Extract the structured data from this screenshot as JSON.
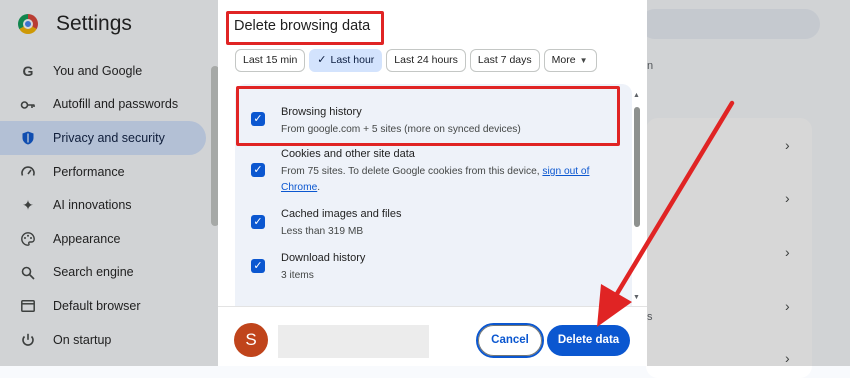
{
  "settings": {
    "title": "Settings",
    "nav": [
      {
        "label": "You and Google",
        "icon": "google-g-icon"
      },
      {
        "label": "Autofill and passwords",
        "icon": "key-icon"
      },
      {
        "label": "Privacy and security",
        "icon": "shield-icon"
      },
      {
        "label": "Performance",
        "icon": "speedometer-icon"
      },
      {
        "label": "AI innovations",
        "icon": "sparkle-icon"
      },
      {
        "label": "Appearance",
        "icon": "palette-icon"
      },
      {
        "label": "Search engine",
        "icon": "search-icon"
      },
      {
        "label": "Default browser",
        "icon": "browser-window-icon"
      },
      {
        "label": "On startup",
        "icon": "power-icon"
      }
    ],
    "active_index": 2,
    "snippet_top": "n",
    "snippet_bottom": "s"
  },
  "dialog": {
    "title": "Delete browsing data",
    "time_ranges": [
      "Last 15 min",
      "Last hour",
      "Last 24 hours",
      "Last 7 days",
      "More"
    ],
    "selected_range": "Last hour",
    "items": [
      {
        "title": "Browsing history",
        "subtitle": "From google.com + 5 sites (more on synced devices)",
        "checked": true
      },
      {
        "title": "Cookies and other site data",
        "subtitle_prefix": "From 75 sites. To delete Google cookies from this device, ",
        "subtitle_link": "sign out of Chrome",
        "subtitle_suffix": ".",
        "checked": true
      },
      {
        "title": "Cached images and files",
        "subtitle": "Less than 319 MB",
        "checked": true
      },
      {
        "title": "Download history",
        "subtitle": "3 items",
        "checked": true
      }
    ],
    "avatar_letter": "S",
    "cancel_label": "Cancel",
    "delete_label": "Delete data"
  },
  "annotation_color": "#e02424",
  "accent_color": "#0b57d0"
}
